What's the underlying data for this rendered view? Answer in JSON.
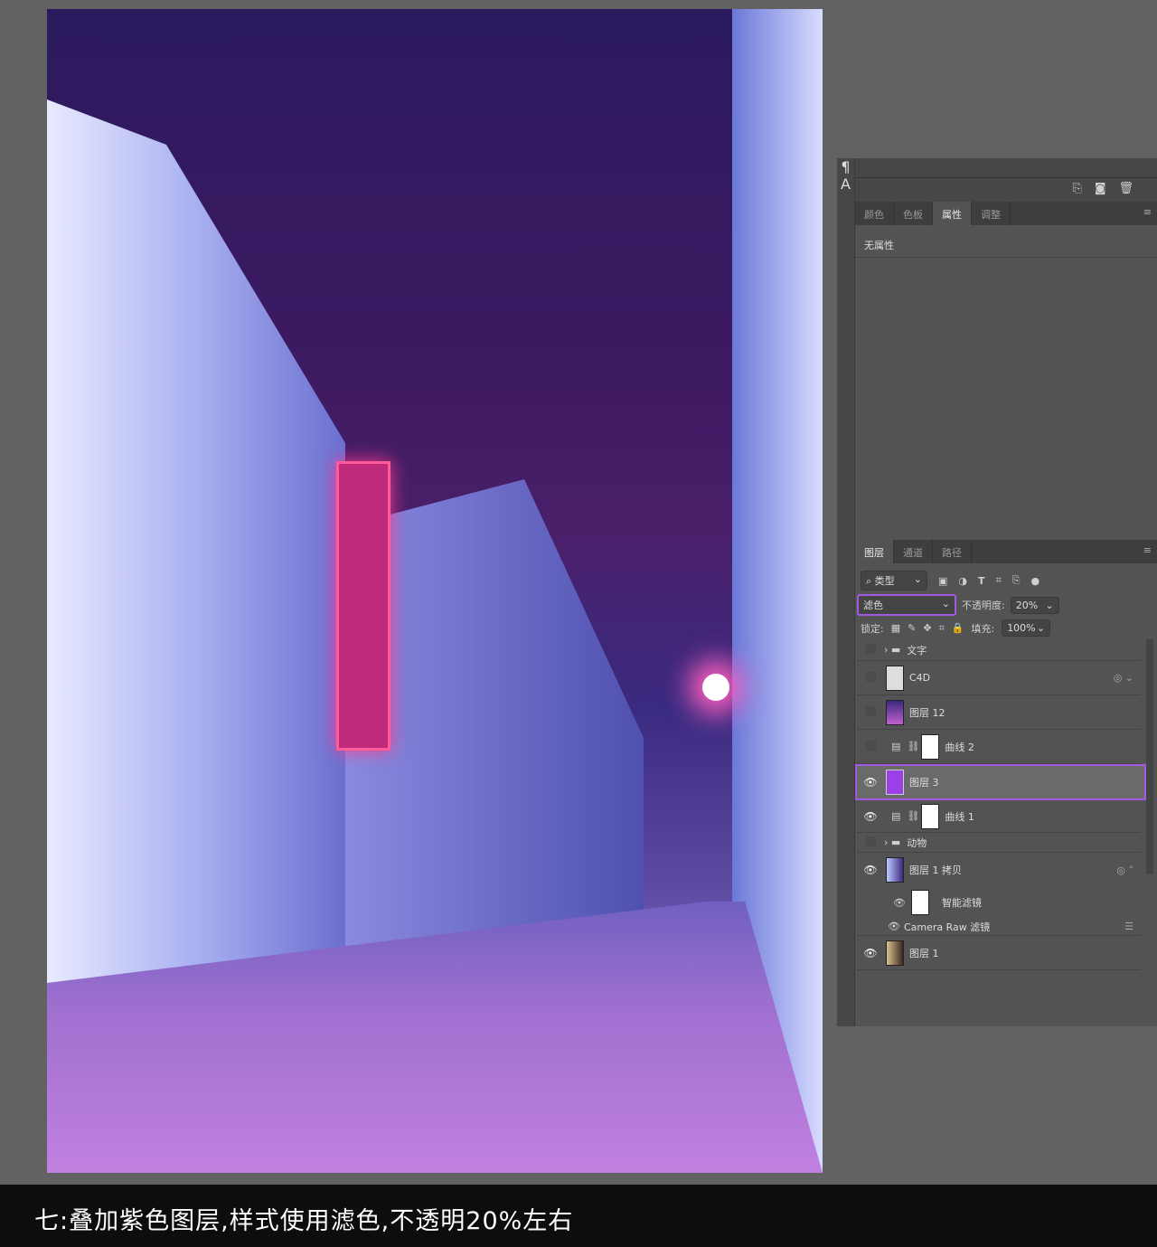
{
  "caption": "七:叠加紫色图层,样式使用滤色,不透明20%左右",
  "left_strip": [
    "¶",
    "A"
  ],
  "icon_bar": [
    "new-snapshot-icon",
    "camera-icon",
    "trash-icon"
  ],
  "top_tabs": [
    {
      "label": "颜色"
    },
    {
      "label": "色板"
    },
    {
      "label": "属性",
      "active": true
    },
    {
      "label": "调整"
    }
  ],
  "properties": {
    "text": "无属性"
  },
  "layers_tabs": [
    {
      "label": "图层",
      "active": true
    },
    {
      "label": "通道"
    },
    {
      "label": "路径"
    }
  ],
  "filter": {
    "kind": "类型"
  },
  "blend_mode": "滤色",
  "opacity_label": "不透明度:",
  "opacity": "20%",
  "lock_label": "锁定:",
  "fill_label": "填充:",
  "fill": "100%",
  "layers": [
    {
      "name": "文字",
      "type": "group",
      "visible": false
    },
    {
      "name": "C4D",
      "type": "smart",
      "visible": false
    },
    {
      "name": "图层 12",
      "type": "image",
      "visible": false
    },
    {
      "name": "曲线 2",
      "type": "curves",
      "visible": false
    },
    {
      "name": "图层 3",
      "type": "fill",
      "visible": true,
      "selected": true,
      "color": "#9b3fe6"
    },
    {
      "name": "曲线 1",
      "type": "curves",
      "visible": true
    },
    {
      "name": "动物",
      "type": "group",
      "visible": false
    },
    {
      "name": "图层 1 拷贝",
      "type": "smart",
      "visible": true
    },
    {
      "name": "智能滤镜",
      "type": "smart-filter",
      "visible": true
    },
    {
      "name": "Camera Raw 滤镜",
      "type": "filter",
      "visible": true
    },
    {
      "name": "图层 1",
      "type": "image",
      "visible": true
    }
  ],
  "colors": {
    "highlight": "#a259e6",
    "panel": "#535353"
  }
}
